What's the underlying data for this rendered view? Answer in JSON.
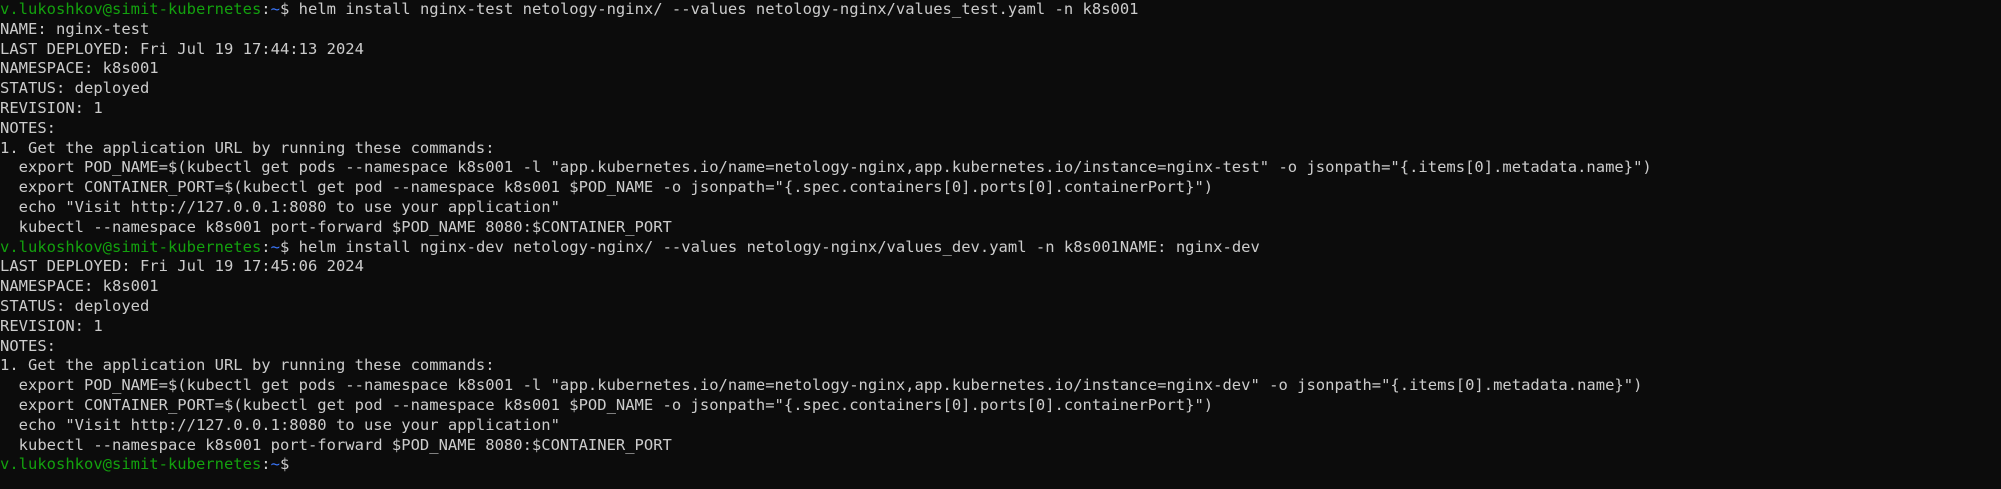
{
  "colors": {
    "background": "#0c0c0c",
    "text": "#cccccc",
    "prompt_user_host": "#13a10e",
    "prompt_path": "#3b78ff"
  },
  "prompt": {
    "user_host": "v.lukoshkov@simit-kubernetes",
    "separator": ":",
    "path": "~",
    "symbol": "$ "
  },
  "lines": [
    {
      "type": "prompt",
      "command": "helm install nginx-test netology-nginx/ --values netology-nginx/values_test.yaml -n k8s001"
    },
    {
      "type": "output",
      "text": "NAME: nginx-test"
    },
    {
      "type": "output",
      "text": "LAST DEPLOYED: Fri Jul 19 17:44:13 2024"
    },
    {
      "type": "output",
      "text": "NAMESPACE: k8s001"
    },
    {
      "type": "output",
      "text": "STATUS: deployed"
    },
    {
      "type": "output",
      "text": "REVISION: 1"
    },
    {
      "type": "output",
      "text": "NOTES:"
    },
    {
      "type": "output",
      "text": "1. Get the application URL by running these commands:"
    },
    {
      "type": "output",
      "text": "  export POD_NAME=$(kubectl get pods --namespace k8s001 -l \"app.kubernetes.io/name=netology-nginx,app.kubernetes.io/instance=nginx-test\" -o jsonpath=\"{.items[0].metadata.name}\")"
    },
    {
      "type": "output",
      "text": "  export CONTAINER_PORT=$(kubectl get pod --namespace k8s001 $POD_NAME -o jsonpath=\"{.spec.containers[0].ports[0].containerPort}\")"
    },
    {
      "type": "output",
      "text": "  echo \"Visit http://127.0.0.1:8080 to use your application\""
    },
    {
      "type": "output",
      "text": "  kubectl --namespace k8s001 port-forward $POD_NAME 8080:$CONTAINER_PORT"
    },
    {
      "type": "prompt",
      "command": "helm install nginx-dev netology-nginx/ --values netology-nginx/values_dev.yaml -n k8s001NAME: nginx-dev"
    },
    {
      "type": "output",
      "text": "LAST DEPLOYED: Fri Jul 19 17:45:06 2024"
    },
    {
      "type": "output",
      "text": "NAMESPACE: k8s001"
    },
    {
      "type": "output",
      "text": "STATUS: deployed"
    },
    {
      "type": "output",
      "text": "REVISION: 1"
    },
    {
      "type": "output",
      "text": "NOTES:"
    },
    {
      "type": "output",
      "text": "1. Get the application URL by running these commands:"
    },
    {
      "type": "output",
      "text": "  export POD_NAME=$(kubectl get pods --namespace k8s001 -l \"app.kubernetes.io/name=netology-nginx,app.kubernetes.io/instance=nginx-dev\" -o jsonpath=\"{.items[0].metadata.name}\")"
    },
    {
      "type": "output",
      "text": "  export CONTAINER_PORT=$(kubectl get pod --namespace k8s001 $POD_NAME -o jsonpath=\"{.spec.containers[0].ports[0].containerPort}\")"
    },
    {
      "type": "output",
      "text": "  echo \"Visit http://127.0.0.1:8080 to use your application\""
    },
    {
      "type": "output",
      "text": "  kubectl --namespace k8s001 port-forward $POD_NAME 8080:$CONTAINER_PORT"
    },
    {
      "type": "prompt",
      "command": ""
    }
  ]
}
